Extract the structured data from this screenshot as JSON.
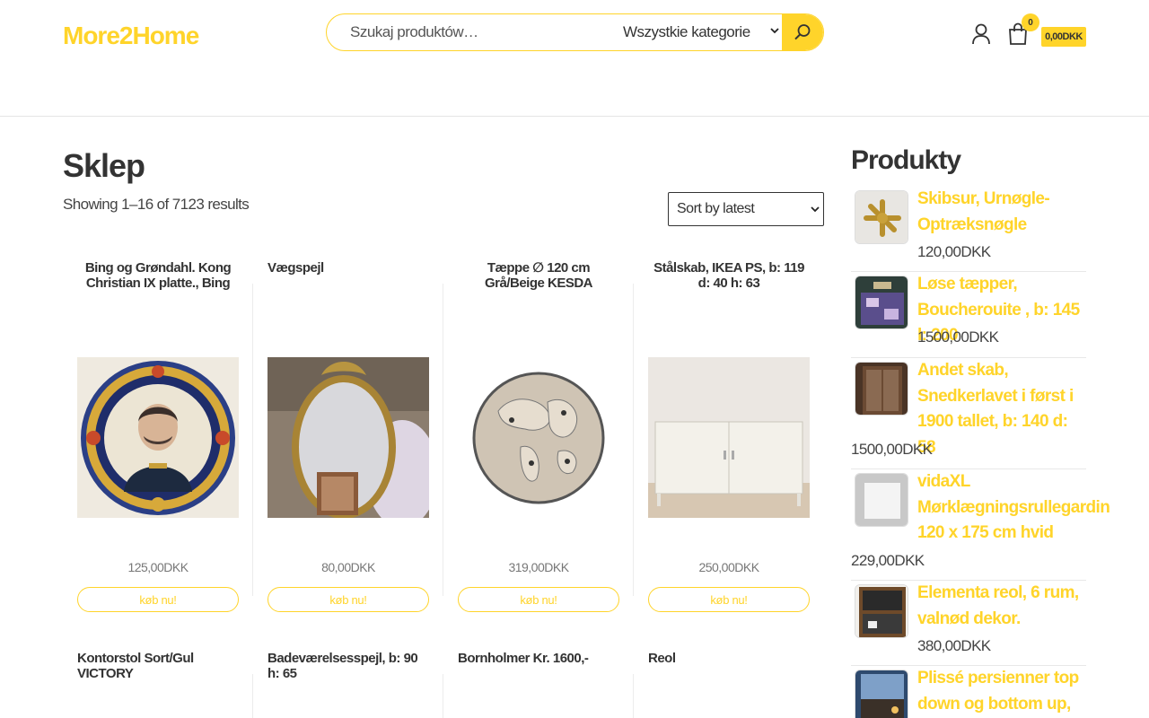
{
  "header": {
    "logo": "More2Home",
    "search_placeholder": "Szukaj produktów…",
    "category_select": "Wszystkie kategorie",
    "cart_count": "0",
    "cart_total": "0,00DKK"
  },
  "main": {
    "title": "Sklep",
    "result_count": "Showing 1–16 of 7123 results",
    "sort_label": "Sort by latest",
    "buy_label": "køb nu!",
    "products": [
      {
        "title": "Bing og Grøndahl. Kong Christian IX platte., Bing og",
        "price": "125,00DKK",
        "image": "plate-image"
      },
      {
        "title": "Vægspejl",
        "price": "80,00DKK",
        "image": "mirror-image"
      },
      {
        "title": "Tæppe ∅ 120 cm Grå/Beige KESDA",
        "price": "319,00DKK",
        "image": "rug-image"
      },
      {
        "title": "Stålskab, IKEA PS, b: 119 d: 40 h: 63",
        "price": "250,00DKK",
        "image": "cabinet-image"
      },
      {
        "title": "Kontorstol Sort/Gul VICTORY"
      },
      {
        "title": "Badeværelsesspejl, b: 90 h: 65"
      },
      {
        "title": "Bornholmer Kr. 1600,-"
      },
      {
        "title": "Reol"
      }
    ]
  },
  "sidebar": {
    "title": "Produkty",
    "items": [
      {
        "name": "Skibsur, Urnøgle-Optræksnøgle",
        "price": "120,00DKK",
        "thumb": "key-thumb"
      },
      {
        "name": "Løse tæpper, Boucherouite , b: 145 l: 200",
        "price": "1500,00DKK",
        "thumb": "rug-thumb"
      },
      {
        "name": "Andet skab, Snedkerlavet i først i 1900 tallet, b: 140 d: 58",
        "price": "1500,00DKK",
        "thumb": "cabinet-thumb"
      },
      {
        "name": "vidaXL Mørklægningsrullegardin 120 x 175 cm hvid",
        "price": "229,00DKK",
        "thumb": "blind-thumb"
      },
      {
        "name": "Elementa reol, 6 rum, valnød dekor.",
        "price": "380,00DKK",
        "thumb": "shelf-thumb"
      },
      {
        "name": "Plissé persienner top down og bottom up, Fra",
        "thumb": "blinds-thumb"
      }
    ]
  },
  "colors": {
    "accent": "#ffd42a",
    "text": "#333333"
  }
}
